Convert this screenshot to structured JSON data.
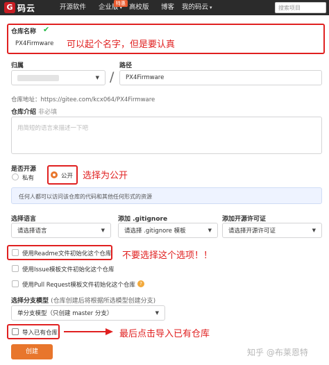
{
  "nav": {
    "logo_mark": "G",
    "logo_text": "码云",
    "items": [
      "开源软件",
      "企业版",
      "高校版",
      "博客",
      "我的码云"
    ],
    "badge": "特惠",
    "search_placeholder": "搜索项目"
  },
  "repo_name": {
    "label": "仓库名称",
    "value": "PX4Firmware",
    "note": "可以起个名字，但是要认真"
  },
  "owner": {
    "label": "归属"
  },
  "path": {
    "label": "路径",
    "separator": "/",
    "value": "PX4Firmware"
  },
  "address": {
    "text": "仓库地址：https://gitee.com/kcx064/PX4Firmware"
  },
  "intro": {
    "label": "仓库介绍",
    "optional": "非必填",
    "placeholder": "用简短的语言来描述一下吧"
  },
  "visibility": {
    "label": "是否开源",
    "private_label": "私有",
    "public_label": "公开",
    "note": "选择为公开",
    "hint": "任何人都可以访问该仓库的代码和其他任何形式的资源"
  },
  "language": {
    "label": "选择语言",
    "value": "请选择语言"
  },
  "gitignore": {
    "label": "添加 .gitignore",
    "value": "请选择 .gitignore 模板"
  },
  "license": {
    "label": "添加开源许可证",
    "value": "请选择开源许可证"
  },
  "options": {
    "readme": "使用Readme文件初始化这个仓库",
    "readme_note": "不要选择这个选项！！",
    "issue": "使用Issue模板文件初始化这个仓库",
    "pr": "使用Pull Request模板文件初始化这个仓库",
    "help_icon": "?"
  },
  "branch": {
    "label": "选择分支模型",
    "hint": "(仓库创建后将根据所选模型创建分支)",
    "value": "单分支模型（只创建 master 分支）"
  },
  "import": {
    "label": "导入已有仓库",
    "note": "最后点击导入已有仓库"
  },
  "create_button": "创建",
  "watermark": "知乎 @布莱恩特",
  "colors": {
    "accent": "#e8762c",
    "annotation": "#e02020",
    "check": "#21ba45",
    "nav_bg": "#2b2b2b"
  }
}
